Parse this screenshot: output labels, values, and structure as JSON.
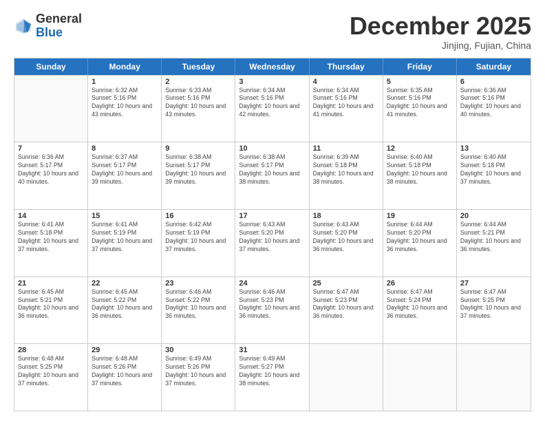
{
  "logo": {
    "line1": "General",
    "line2": "Blue"
  },
  "title": "December 2025",
  "subtitle": "Jinjing, Fujian, China",
  "days_of_week": [
    "Sunday",
    "Monday",
    "Tuesday",
    "Wednesday",
    "Thursday",
    "Friday",
    "Saturday"
  ],
  "weeks": [
    [
      {
        "day": "",
        "empty": true
      },
      {
        "day": "1",
        "sunrise": "6:32 AM",
        "sunset": "5:16 PM",
        "daylight": "10 hours and 43 minutes."
      },
      {
        "day": "2",
        "sunrise": "6:33 AM",
        "sunset": "5:16 PM",
        "daylight": "10 hours and 43 minutes."
      },
      {
        "day": "3",
        "sunrise": "6:34 AM",
        "sunset": "5:16 PM",
        "daylight": "10 hours and 42 minutes."
      },
      {
        "day": "4",
        "sunrise": "6:34 AM",
        "sunset": "5:16 PM",
        "daylight": "10 hours and 41 minutes."
      },
      {
        "day": "5",
        "sunrise": "6:35 AM",
        "sunset": "5:16 PM",
        "daylight": "10 hours and 41 minutes."
      },
      {
        "day": "6",
        "sunrise": "6:36 AM",
        "sunset": "5:16 PM",
        "daylight": "10 hours and 40 minutes."
      }
    ],
    [
      {
        "day": "7",
        "sunrise": "6:36 AM",
        "sunset": "5:17 PM",
        "daylight": "10 hours and 40 minutes."
      },
      {
        "day": "8",
        "sunrise": "6:37 AM",
        "sunset": "5:17 PM",
        "daylight": "10 hours and 39 minutes."
      },
      {
        "day": "9",
        "sunrise": "6:38 AM",
        "sunset": "5:17 PM",
        "daylight": "10 hours and 39 minutes."
      },
      {
        "day": "10",
        "sunrise": "6:38 AM",
        "sunset": "5:17 PM",
        "daylight": "10 hours and 38 minutes."
      },
      {
        "day": "11",
        "sunrise": "6:39 AM",
        "sunset": "5:18 PM",
        "daylight": "10 hours and 38 minutes."
      },
      {
        "day": "12",
        "sunrise": "6:40 AM",
        "sunset": "5:18 PM",
        "daylight": "10 hours and 38 minutes."
      },
      {
        "day": "13",
        "sunrise": "6:40 AM",
        "sunset": "5:18 PM",
        "daylight": "10 hours and 37 minutes."
      }
    ],
    [
      {
        "day": "14",
        "sunrise": "6:41 AM",
        "sunset": "5:18 PM",
        "daylight": "10 hours and 37 minutes."
      },
      {
        "day": "15",
        "sunrise": "6:41 AM",
        "sunset": "5:19 PM",
        "daylight": "10 hours and 37 minutes."
      },
      {
        "day": "16",
        "sunrise": "6:42 AM",
        "sunset": "5:19 PM",
        "daylight": "10 hours and 37 minutes."
      },
      {
        "day": "17",
        "sunrise": "6:43 AM",
        "sunset": "5:20 PM",
        "daylight": "10 hours and 37 minutes."
      },
      {
        "day": "18",
        "sunrise": "6:43 AM",
        "sunset": "5:20 PM",
        "daylight": "10 hours and 36 minutes."
      },
      {
        "day": "19",
        "sunrise": "6:44 AM",
        "sunset": "5:20 PM",
        "daylight": "10 hours and 36 minutes."
      },
      {
        "day": "20",
        "sunrise": "6:44 AM",
        "sunset": "5:21 PM",
        "daylight": "10 hours and 36 minutes."
      }
    ],
    [
      {
        "day": "21",
        "sunrise": "6:45 AM",
        "sunset": "5:21 PM",
        "daylight": "10 hours and 36 minutes."
      },
      {
        "day": "22",
        "sunrise": "6:45 AM",
        "sunset": "5:22 PM",
        "daylight": "10 hours and 36 minutes."
      },
      {
        "day": "23",
        "sunrise": "6:46 AM",
        "sunset": "5:22 PM",
        "daylight": "10 hours and 36 minutes."
      },
      {
        "day": "24",
        "sunrise": "6:46 AM",
        "sunset": "5:23 PM",
        "daylight": "10 hours and 36 minutes."
      },
      {
        "day": "25",
        "sunrise": "6:47 AM",
        "sunset": "5:23 PM",
        "daylight": "10 hours and 36 minutes."
      },
      {
        "day": "26",
        "sunrise": "6:47 AM",
        "sunset": "5:24 PM",
        "daylight": "10 hours and 36 minutes."
      },
      {
        "day": "27",
        "sunrise": "6:47 AM",
        "sunset": "5:25 PM",
        "daylight": "10 hours and 37 minutes."
      }
    ],
    [
      {
        "day": "28",
        "sunrise": "6:48 AM",
        "sunset": "5:25 PM",
        "daylight": "10 hours and 37 minutes."
      },
      {
        "day": "29",
        "sunrise": "6:48 AM",
        "sunset": "5:26 PM",
        "daylight": "10 hours and 37 minutes."
      },
      {
        "day": "30",
        "sunrise": "6:49 AM",
        "sunset": "5:26 PM",
        "daylight": "10 hours and 37 minutes."
      },
      {
        "day": "31",
        "sunrise": "6:49 AM",
        "sunset": "5:27 PM",
        "daylight": "10 hours and 38 minutes."
      },
      {
        "day": "",
        "empty": true
      },
      {
        "day": "",
        "empty": true
      },
      {
        "day": "",
        "empty": true
      }
    ]
  ]
}
